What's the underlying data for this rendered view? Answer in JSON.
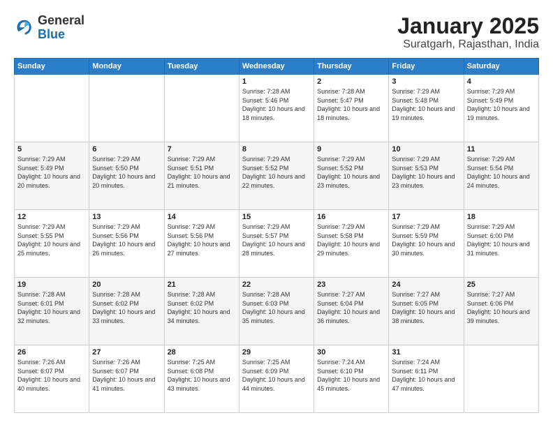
{
  "header": {
    "logo": {
      "general": "General",
      "blue": "Blue"
    },
    "title": "January 2025",
    "location": "Suratgarh, Rajasthan, India"
  },
  "days_of_week": [
    "Sunday",
    "Monday",
    "Tuesday",
    "Wednesday",
    "Thursday",
    "Friday",
    "Saturday"
  ],
  "weeks": [
    {
      "cells": [
        {
          "empty": true
        },
        {
          "empty": true
        },
        {
          "empty": true
        },
        {
          "day": 1,
          "sunrise": "7:28 AM",
          "sunset": "5:46 PM",
          "daylight": "10 hours and 18 minutes."
        },
        {
          "day": 2,
          "sunrise": "7:28 AM",
          "sunset": "5:47 PM",
          "daylight": "10 hours and 18 minutes."
        },
        {
          "day": 3,
          "sunrise": "7:29 AM",
          "sunset": "5:48 PM",
          "daylight": "10 hours and 19 minutes."
        },
        {
          "day": 4,
          "sunrise": "7:29 AM",
          "sunset": "5:49 PM",
          "daylight": "10 hours and 19 minutes."
        }
      ]
    },
    {
      "cells": [
        {
          "day": 5,
          "sunrise": "7:29 AM",
          "sunset": "5:49 PM",
          "daylight": "10 hours and 20 minutes."
        },
        {
          "day": 6,
          "sunrise": "7:29 AM",
          "sunset": "5:50 PM",
          "daylight": "10 hours and 20 minutes."
        },
        {
          "day": 7,
          "sunrise": "7:29 AM",
          "sunset": "5:51 PM",
          "daylight": "10 hours and 21 minutes."
        },
        {
          "day": 8,
          "sunrise": "7:29 AM",
          "sunset": "5:52 PM",
          "daylight": "10 hours and 22 minutes."
        },
        {
          "day": 9,
          "sunrise": "7:29 AM",
          "sunset": "5:52 PM",
          "daylight": "10 hours and 23 minutes."
        },
        {
          "day": 10,
          "sunrise": "7:29 AM",
          "sunset": "5:53 PM",
          "daylight": "10 hours and 23 minutes."
        },
        {
          "day": 11,
          "sunrise": "7:29 AM",
          "sunset": "5:54 PM",
          "daylight": "10 hours and 24 minutes."
        }
      ]
    },
    {
      "cells": [
        {
          "day": 12,
          "sunrise": "7:29 AM",
          "sunset": "5:55 PM",
          "daylight": "10 hours and 25 minutes."
        },
        {
          "day": 13,
          "sunrise": "7:29 AM",
          "sunset": "5:56 PM",
          "daylight": "10 hours and 26 minutes."
        },
        {
          "day": 14,
          "sunrise": "7:29 AM",
          "sunset": "5:56 PM",
          "daylight": "10 hours and 27 minutes."
        },
        {
          "day": 15,
          "sunrise": "7:29 AM",
          "sunset": "5:57 PM",
          "daylight": "10 hours and 28 minutes."
        },
        {
          "day": 16,
          "sunrise": "7:29 AM",
          "sunset": "5:58 PM",
          "daylight": "10 hours and 29 minutes."
        },
        {
          "day": 17,
          "sunrise": "7:29 AM",
          "sunset": "5:59 PM",
          "daylight": "10 hours and 30 minutes."
        },
        {
          "day": 18,
          "sunrise": "7:29 AM",
          "sunset": "6:00 PM",
          "daylight": "10 hours and 31 minutes."
        }
      ]
    },
    {
      "cells": [
        {
          "day": 19,
          "sunrise": "7:28 AM",
          "sunset": "6:01 PM",
          "daylight": "10 hours and 32 minutes."
        },
        {
          "day": 20,
          "sunrise": "7:28 AM",
          "sunset": "6:02 PM",
          "daylight": "10 hours and 33 minutes."
        },
        {
          "day": 21,
          "sunrise": "7:28 AM",
          "sunset": "6:02 PM",
          "daylight": "10 hours and 34 minutes."
        },
        {
          "day": 22,
          "sunrise": "7:28 AM",
          "sunset": "6:03 PM",
          "daylight": "10 hours and 35 minutes."
        },
        {
          "day": 23,
          "sunrise": "7:27 AM",
          "sunset": "6:04 PM",
          "daylight": "10 hours and 36 minutes."
        },
        {
          "day": 24,
          "sunrise": "7:27 AM",
          "sunset": "6:05 PM",
          "daylight": "10 hours and 38 minutes."
        },
        {
          "day": 25,
          "sunrise": "7:27 AM",
          "sunset": "6:06 PM",
          "daylight": "10 hours and 39 minutes."
        }
      ]
    },
    {
      "cells": [
        {
          "day": 26,
          "sunrise": "7:26 AM",
          "sunset": "6:07 PM",
          "daylight": "10 hours and 40 minutes."
        },
        {
          "day": 27,
          "sunrise": "7:26 AM",
          "sunset": "6:07 PM",
          "daylight": "10 hours and 41 minutes."
        },
        {
          "day": 28,
          "sunrise": "7:25 AM",
          "sunset": "6:08 PM",
          "daylight": "10 hours and 43 minutes."
        },
        {
          "day": 29,
          "sunrise": "7:25 AM",
          "sunset": "6:09 PM",
          "daylight": "10 hours and 44 minutes."
        },
        {
          "day": 30,
          "sunrise": "7:24 AM",
          "sunset": "6:10 PM",
          "daylight": "10 hours and 45 minutes."
        },
        {
          "day": 31,
          "sunrise": "7:24 AM",
          "sunset": "6:11 PM",
          "daylight": "10 hours and 47 minutes."
        },
        {
          "empty": true
        }
      ]
    }
  ],
  "labels": {
    "sunrise": "Sunrise:",
    "sunset": "Sunset:",
    "daylight": "Daylight:"
  }
}
